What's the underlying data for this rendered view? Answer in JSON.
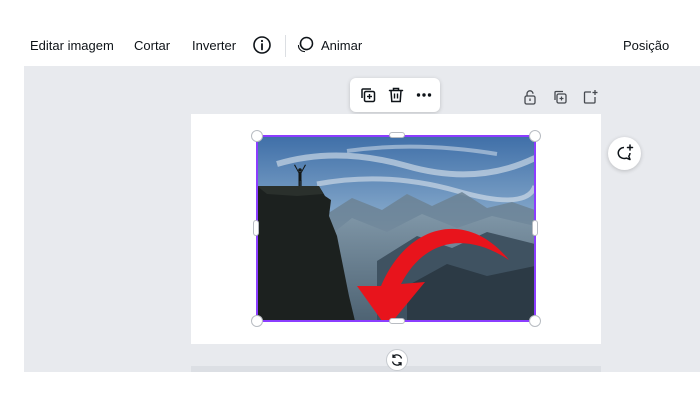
{
  "toolbar": {
    "edit_image_label": "Editar imagem",
    "crop_label": "Cortar",
    "flip_label": "Inverter",
    "info_icon": "info-icon",
    "animate_icon": "animate-icon",
    "animate_label": "Animar",
    "position_label": "Posição"
  },
  "floating_toolbar": {
    "icons": [
      "duplicate-icon",
      "trash-icon",
      "more-icon"
    ]
  },
  "page_controls": {
    "icons": [
      "lock-icon",
      "duplicate-page-icon",
      "add-page-icon"
    ]
  },
  "side": {
    "comment_icon": "add-comment-icon"
  },
  "selection": {
    "rotate_icon": "rotate-icon",
    "border_color": "#8b3dff"
  },
  "colors": {
    "accent": "#8b3dff",
    "canvas_bg": "#e8eaee",
    "arrow_red": "#e8141c"
  }
}
